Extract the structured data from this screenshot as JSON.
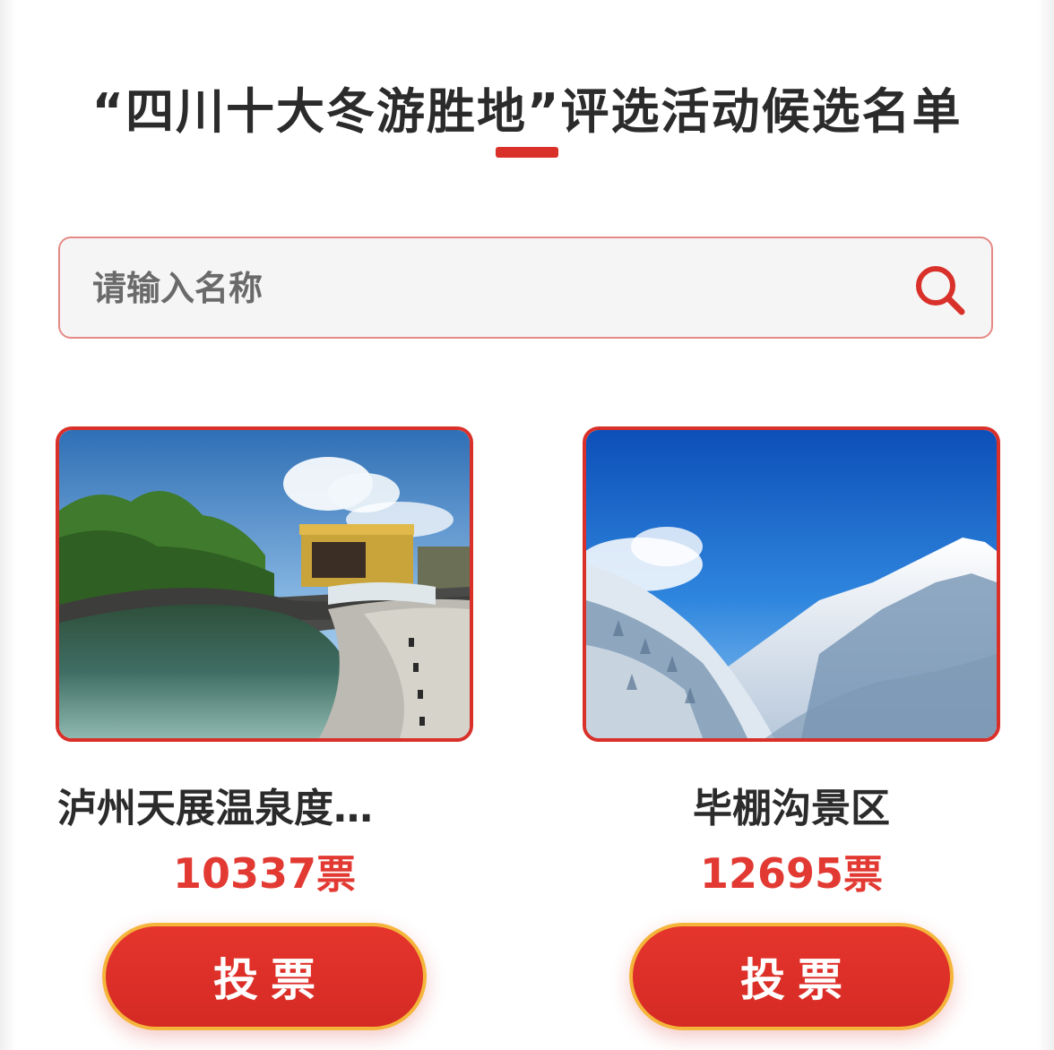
{
  "header": {
    "title": "“四川十大冬游胜地”评选活动候选名单"
  },
  "search": {
    "placeholder": "请输入名称",
    "icon": "search-icon"
  },
  "candidates": [
    {
      "name": "泸州天展温泉度…",
      "votes": "10337",
      "votes_unit": "票",
      "vote_label": "投票",
      "image": "hot-spring-pool-photo"
    },
    {
      "name": "毕棚沟景区",
      "votes": "12695",
      "votes_unit": "票",
      "vote_label": "投票",
      "image": "snowy-mountain-valley-photo"
    }
  ],
  "colors": {
    "accent": "#d9302a",
    "vote_text": "#e23a33",
    "button_border": "#f4b53a",
    "title_text": "#2b2b2b"
  }
}
